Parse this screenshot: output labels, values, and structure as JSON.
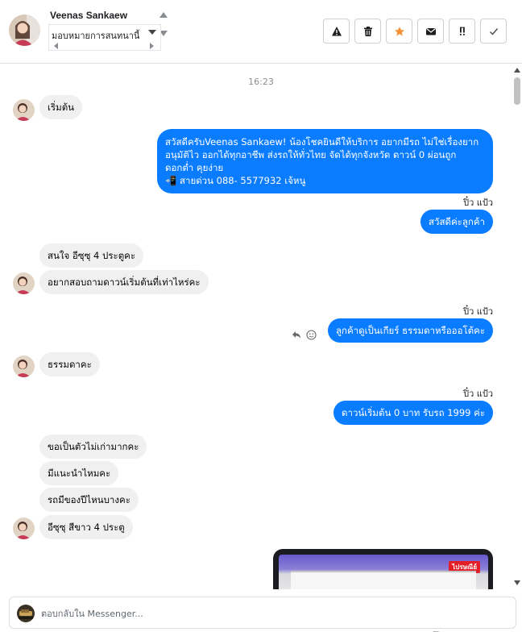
{
  "header": {
    "contact_name": "Veenas Sankaew",
    "assign_value": "มอบหมายการสนทนานี้",
    "actions": [
      {
        "name": "report-spam-button",
        "icon": "warning-icon"
      },
      {
        "name": "delete-button",
        "icon": "trash-icon"
      },
      {
        "name": "star-button",
        "icon": "star-icon"
      },
      {
        "name": "mark-unread-button",
        "icon": "envelope-icon"
      },
      {
        "name": "follow-up-button",
        "icon": "follow-up-icon"
      },
      {
        "name": "mark-done-button",
        "icon": "checkmark-icon"
      }
    ]
  },
  "conversation": {
    "timestamp": "16:23",
    "sender_name": "ปิ๋ว แป้ว",
    "messages": {
      "m1": "เริ่มต้น",
      "m2_line1": "สวัสดีครับVeenas Sankaew! น้องโชคยินดีให้บริการ อยากมีรถ ไม่ใช่เรื่องยาก",
      "m2_line2": "อนุมัติไว ออกได้ทุกอาชีพ ส่งรถให้ทั่วไทย จัดได้ทุกจังหวัด ดาวน์ 0 ผ่อนถูก",
      "m2_line3": "ดอกต่ำ คุยง่าย",
      "m2_line4": "📲 สายด่วน 088- 5577932 เจ้หนู",
      "m3": "สวัสดีค่ะลูกค้า",
      "m4": "สนใจ อีซุซุ 4 ประตูคะ",
      "m5": "อยากสอบถามดาวน์เริ่มต้นที่เท่าไหร่คะ",
      "m6": "ลูกค้าดูเป็นเกียร์ ธรรมดาหรือออโต้คะ",
      "m7": "ธรรมดาคะ",
      "m8": "ดาวน์เริ่มต้น 0 บาท รับรถ 1999 ค่ะ",
      "m9": "ขอเป็นตัวไม่เก่ามากคะ",
      "m10": "มีแนะนำไหมคะ",
      "m11": "รถมีของปีไหนบางคะ",
      "m12": "อีซุซุ สีขาว 4 ประตู"
    },
    "media_badge": "ไปรษณีย์"
  },
  "composer": {
    "placeholder": "ตอบกลับใน Messenger..."
  },
  "colors": {
    "outgoing_bubble": "#0a7cff",
    "incoming_bubble": "#f0f0f0",
    "star_accent": "#f7923b"
  }
}
